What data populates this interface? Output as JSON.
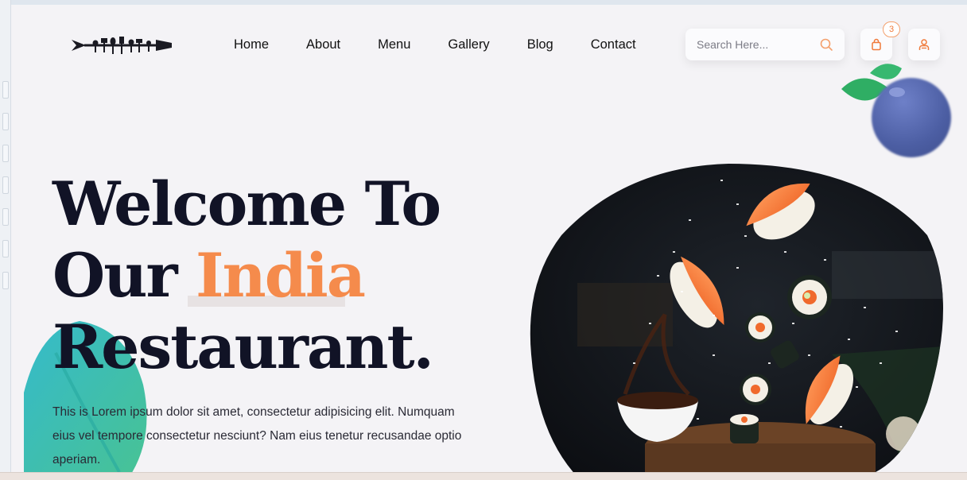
{
  "header": {
    "nav": [
      "Home",
      "About",
      "Menu",
      "Gallery",
      "Blog",
      "Contact"
    ],
    "search_placeholder": "Search Here...",
    "cart_count": "3"
  },
  "hero": {
    "line1": "Welcome To",
    "line2_prefix": "Our ",
    "line2_accent": "India",
    "line3": "Restaurant.",
    "description": "This is Lorem ipsum dolor sit amet, consectetur adipisicing elit. Numquam eius vel tempore consectetur nesciunt? Nam eius tenetur recusandae optio aperiam."
  },
  "colors": {
    "accent": "#f58b4c",
    "heading": "#111326",
    "background": "#f4f3f6"
  },
  "icons": {
    "search": "search-icon",
    "cart": "shopping-bag-icon",
    "user": "user-icon"
  }
}
